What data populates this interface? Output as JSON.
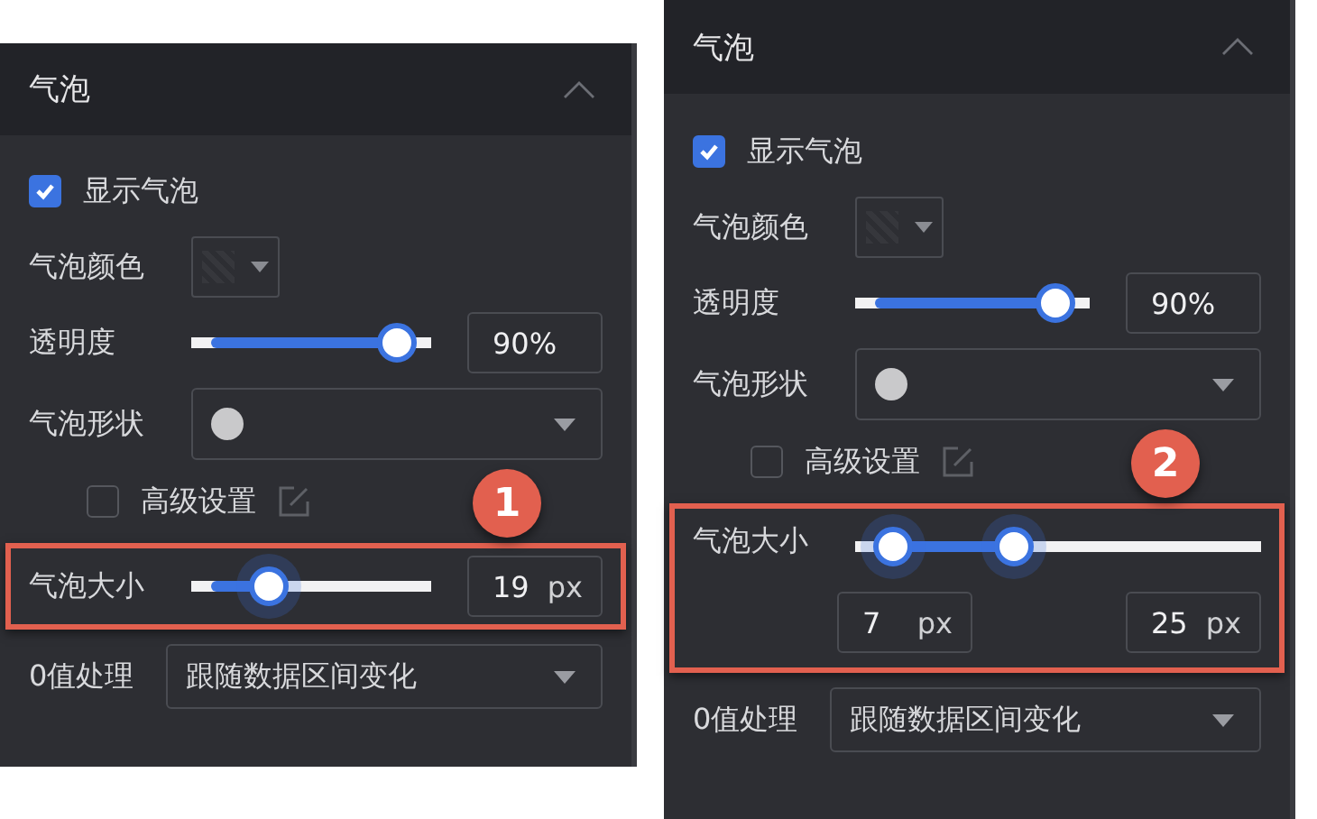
{
  "panels": [
    {
      "title": "气泡",
      "show_bubble": {
        "label": "显示气泡",
        "checked": true
      },
      "color_label": "气泡颜色",
      "opacity": {
        "label": "透明度",
        "level": 0.93,
        "value": "90%"
      },
      "shape_label": "气泡形状",
      "advanced": {
        "label": "高级设置",
        "checked": false
      },
      "size": {
        "kind": "single",
        "label": "气泡大小",
        "highlighted": true,
        "thumbs": [
          {
            "level": 0.29
          }
        ],
        "inputs": [
          {
            "value": "19",
            "unit": "px"
          }
        ]
      },
      "zero": {
        "label": "0值处理",
        "value": "跟随数据区间变化"
      },
      "badge": "1"
    },
    {
      "title": "气泡",
      "show_bubble": {
        "label": "显示气泡",
        "checked": true
      },
      "color_label": "气泡颜色",
      "opacity": {
        "label": "透明度",
        "level": 0.93,
        "value": "90%"
      },
      "shape_label": "气泡形状",
      "advanced": {
        "label": "高级设置",
        "checked": false
      },
      "size": {
        "kind": "range",
        "label": "气泡大小",
        "highlighted": true,
        "thumbs": [
          {
            "level": 0.05
          },
          {
            "level": 0.38
          }
        ],
        "inputs": [
          {
            "value": "7",
            "unit": "px"
          },
          {
            "value": "25",
            "unit": "px"
          }
        ]
      },
      "zero": {
        "label": "0值处理",
        "value": "跟随数据区间变化"
      },
      "badge": "2"
    }
  ]
}
